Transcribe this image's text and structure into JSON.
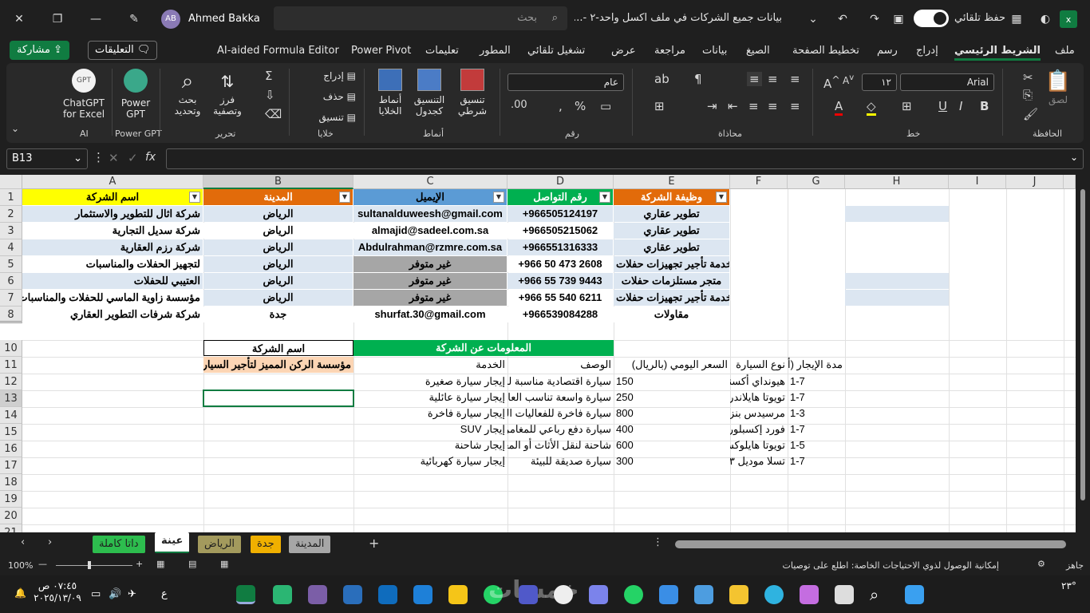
{
  "titlebar": {
    "document_title": "بيانات جميع الشركات في ملف اكسل واحد-٢ -...",
    "search_placeholder": "بحث",
    "autosave_label": "حفظ تلقائي",
    "user_name": "Ahmed Bakka",
    "user_initials": "AB"
  },
  "menu": {
    "items": [
      "ملف",
      "الشريط الرئيسي",
      "إدراج",
      "رسم",
      "تخطيط الصفحة",
      "الصيغ",
      "بيانات",
      "مراجعة",
      "عرض",
      "تشغيل تلقائي",
      "المطور",
      "تعليمات",
      "Power Pivot",
      "AI-aided Formula Editor"
    ],
    "active": "الشريط الرئيسي",
    "share_label": "مشاركة",
    "comments_label": "التعليقات"
  },
  "ribbon": {
    "clipboard": {
      "label": "الحافظة",
      "paste": "لصق"
    },
    "font": {
      "label": "خط",
      "name": "Arial",
      "size": "١٢"
    },
    "alignment": {
      "label": "محاذاة"
    },
    "number": {
      "label": "رقم",
      "format": "عام"
    },
    "styles": {
      "label": "أنماط",
      "conditional": "تنسيق شرطي",
      "as_table": "التنسيق كجدول",
      "cell_styles": "أنماط الخلايا"
    },
    "cells": {
      "label": "خلايا",
      "insert": "إدراج",
      "delete": "حذف",
      "format": "تنسيق"
    },
    "editing": {
      "label": "تحرير",
      "sort": "فرز وتصفية",
      "find": "بحث وتحديد"
    },
    "powergpt": {
      "label": "Power GPT",
      "button": "Power GPT"
    },
    "ai": {
      "label": "AI",
      "button": "ChatGPT for Excel"
    }
  },
  "formula_bar": {
    "name_box": "B13",
    "fx": "fx",
    "content": ""
  },
  "columns": [
    "A",
    "B",
    "C",
    "D",
    "E",
    "F",
    "G",
    "H",
    "I",
    "J"
  ],
  "rows": [
    "1",
    "2",
    "3",
    "4",
    "5",
    "6",
    "7",
    "8",
    "10",
    "11",
    "12",
    "13",
    "14",
    "15",
    "16",
    "17",
    "18",
    "19",
    "20",
    "21"
  ],
  "table": {
    "headers": [
      "اسم الشركة",
      "المدينة",
      "الإيميل",
      "رقم التواصل",
      "وظيفة الشركة"
    ],
    "rows": [
      [
        "شركة اثال للتطوير والاستثمار",
        "الرياض",
        "sultanalduweesh@gmail.com",
        "+966505124197",
        "تطوير عقاري"
      ],
      [
        "شركة سديل التجارية",
        "الرياض",
        "almajid@sadeel.com.sa",
        "+966505215062",
        "تطوير عقاري"
      ],
      [
        "شركة رزم العقارية",
        "الرياض",
        "Abdulrahman@rzmre.com.sa",
        "+966551316333",
        "تطوير عقاري"
      ],
      [
        "لتجهيز الحفلات والمناسبات",
        "الرياض",
        "غير متوفر",
        "+966 50 473 2608",
        "خدمة تأجير تجهيزات حفلات"
      ],
      [
        "العتيبي للحفلات",
        "الرياض",
        "غير متوفر",
        "+966 55 739 9443",
        "متجر مستلزمات حفلات"
      ],
      [
        "مؤسسة زاوية الماسي للحفلات والمناسبات",
        "الرياض",
        "غير متوفر",
        "+966 55 540 6211",
        "خدمة تأجير تجهيزات حفلات"
      ],
      [
        "شركة شرفات التطوير العقاري",
        "جدة",
        "shurfat.30@gmail.com",
        "+966539084288",
        "مقاولات"
      ]
    ]
  },
  "sample": {
    "company_label": "اسم الشركة",
    "company_name": "مؤسسة الركن المميز لتأجير السيارات",
    "info_label": "المعلومات عن الشركة",
    "subheaders": [
      "الخدمة",
      "الوصف",
      "السعر اليومي (بالريال)",
      "نوع السيارة",
      "مدة الإيجار (أيام)"
    ],
    "rows": [
      [
        "إيجار سيارة صغيرة",
        "سيارة اقتصادية مناسبة للتنقل",
        "150",
        "هيونداي أكسنت",
        "1-7"
      ],
      [
        "إيجار سيارة عائلية",
        "سيارة واسعة تناسب العائلة",
        "250",
        "تويوتا هايلاندر",
        "1-7"
      ],
      [
        "إيجار سيارة فاخرة",
        "سيارة فاخرة للفعاليات الخاصة",
        "800",
        "مرسيدس بنز",
        "1-3"
      ],
      [
        "إيجار SUV",
        "سيارة دفع رباعي للمغامرات",
        "400",
        "فورد إكسبلورر",
        "1-7"
      ],
      [
        "إيجار شاحنة",
        "شاحنة لنقل الأثاث أو المعدات",
        "600",
        "تويوتا هايلوكس",
        "1-5"
      ],
      [
        "إيجار سيارة كهربائية",
        "سيارة صديقة للبيئة",
        "300",
        "تسلا موديل ٣",
        "1-7"
      ]
    ]
  },
  "sheets": [
    {
      "label": "داتا كاملة",
      "color": "#2dbd4e"
    },
    {
      "label": "عينة",
      "color": "#ffffff"
    },
    {
      "label": "الرياض",
      "color": "#a39a5d"
    },
    {
      "label": "جدة",
      "color": "#f0b000"
    },
    {
      "label": "المدينة",
      "color": "#a6a6a6"
    }
  ],
  "status": {
    "ready": "جاهز",
    "accessibility": "إمكانية الوصول لذوي الاحتياجات الخاصة: اطلع على توصيات",
    "zoom": "100%"
  },
  "taskbar": {
    "time": "٠٧:٤٥ ص",
    "date": "٢٠٢٥/١٣/٠٩",
    "temp": "٢٣°",
    "lang": "ع",
    "watermark": "خمسات"
  },
  "colors": {
    "excel_green": "#107c41",
    "yellow": "#ffff00",
    "orange": "#e26b0a",
    "blue": "#5b9bd5",
    "green": "#00b050",
    "purple": "#8064a2",
    "light_blue": "#dce6f1",
    "gray": "#a6a6a6",
    "peach": "#fcd5b4"
  }
}
